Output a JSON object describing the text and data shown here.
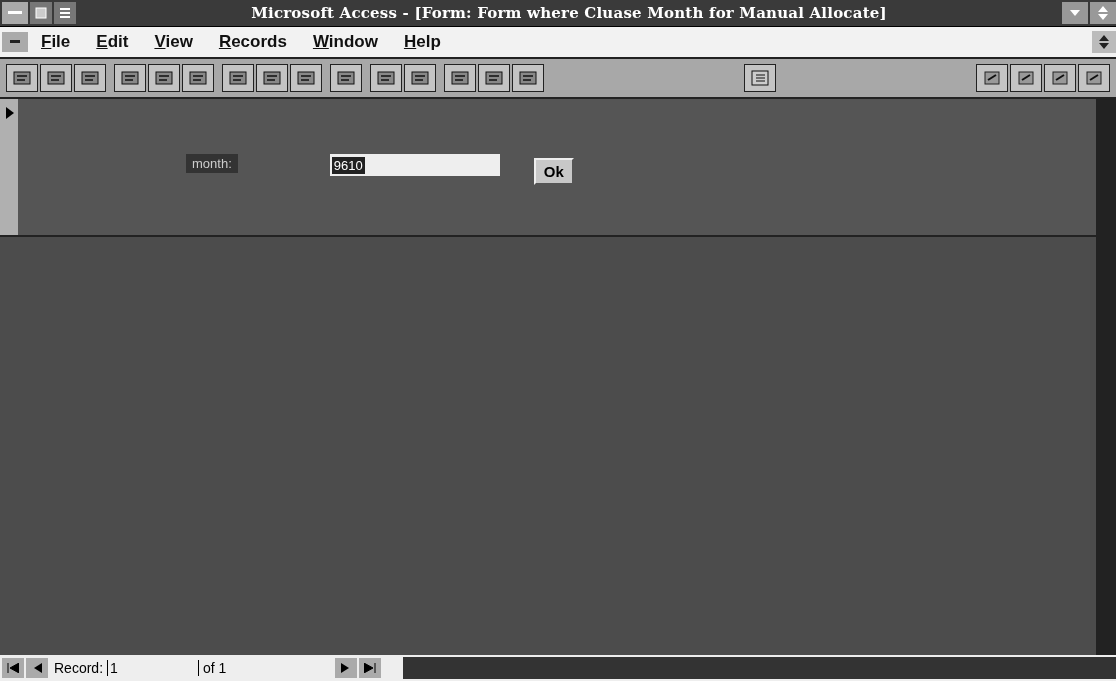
{
  "window": {
    "title": "Microsoft Access - [Form: Form where Cluase Month for Manual Allocate]"
  },
  "menu": [
    {
      "label": "File"
    },
    {
      "label": "Edit"
    },
    {
      "label": "View"
    },
    {
      "label": "Records"
    },
    {
      "label": "Window"
    },
    {
      "label": "Help"
    }
  ],
  "form": {
    "label": "month:",
    "field": {
      "value": "9610"
    },
    "button": "Ok"
  },
  "navigation": {
    "label": "Record:",
    "value": "1",
    "total": "of 1"
  }
}
